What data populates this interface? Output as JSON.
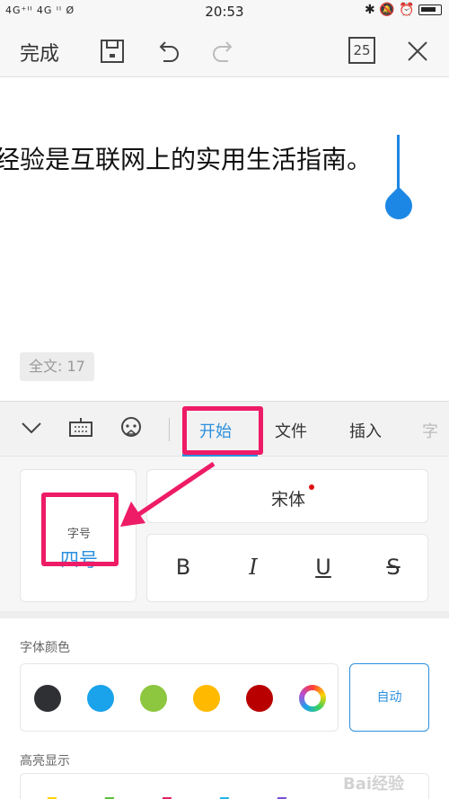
{
  "status_bar": {
    "network": "4G⁺ᴵᴵ 4G ᴵᴵ Ø",
    "time": "20:53",
    "icons": [
      "bluetooth-icon",
      "mute-icon",
      "alarm-icon",
      "battery-icon"
    ]
  },
  "toolbar": {
    "done_label": "完成",
    "page_badge": "25",
    "icons": [
      "save-icon",
      "undo-icon",
      "redo-icon",
      "close-icon"
    ]
  },
  "document": {
    "text": "经验是互联网上的实用生活指南。",
    "word_count": "全文: 17"
  },
  "ribbon": {
    "tabs": [
      {
        "label": "开始",
        "active": true
      },
      {
        "label": "文件",
        "active": false
      },
      {
        "label": "插入",
        "active": false
      }
    ],
    "overflow_glyph": "字"
  },
  "format": {
    "font_size_label": "字号",
    "font_size_value": "四号",
    "font_name": "宋体",
    "styles": [
      "B",
      "I",
      "U",
      "S"
    ]
  },
  "colors": {
    "section_title": "字体颜色",
    "swatches": [
      "#2f3033",
      "#1aa3eb",
      "#8dc63f",
      "#ffba00",
      "#b80000",
      "rainbow"
    ],
    "auto_label": "自动"
  },
  "highlight": {
    "section_title": "高亮显示",
    "marks": [
      "#ffd200",
      "#5ac038",
      "#e0245e",
      "#22b5e6",
      "#7b4fd6"
    ]
  },
  "watermark": "Bai经验",
  "accent_color": "#2a8fde",
  "annotation_color": "#ee1b66"
}
